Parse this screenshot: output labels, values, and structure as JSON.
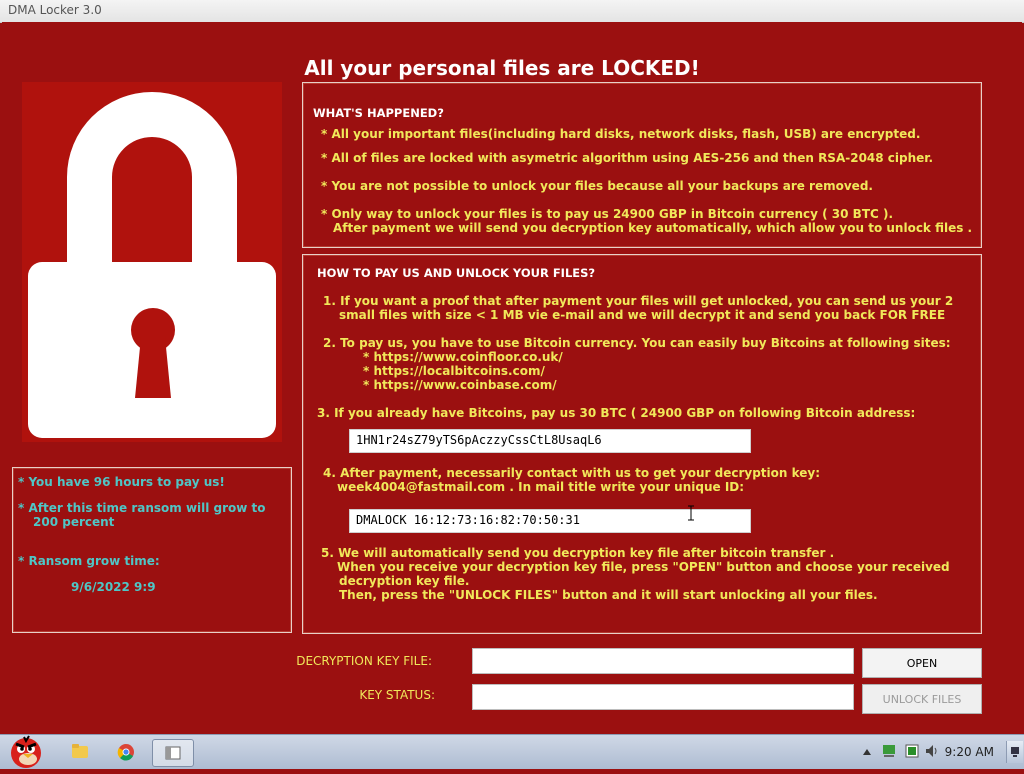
{
  "window": {
    "title": "DMA Locker 3.0"
  },
  "headline": "All your personal files are LOCKED!",
  "left_panel": {
    "lines": [
      "* You have 96 hours to pay us!",
      "* After this time ransom will grow to",
      "200 percent",
      "* Ransom grow time:",
      "9/6/2022 9:9"
    ]
  },
  "happened": {
    "heading": "WHAT'S HAPPENED?",
    "lines": [
      "* All your important files(including hard disks, network disks, flash, USB) are encrypted.",
      "* All of files are locked with asymetric algorithm using AES-256 and then RSA-2048 cipher.",
      "* You are not possible to unlock your files because all your backups are removed.",
      "* Only way to unlock your files is to pay us   24900 GBP in Bitcoin currency ( 30 BTC ).",
      "After payment we will send you decryption key automatically, which allow you to unlock files ."
    ]
  },
  "howto": {
    "heading": "HOW TO PAY US AND UNLOCK YOUR FILES?",
    "lines": [
      "1. If you want a proof that after payment your files will get unlocked, you can send us your 2",
      "small files with size < 1 MB vie e-mail and we will decrypt it and send you back FOR FREE",
      "2. To pay us, you have to use  Bitcoin   currency. You can easily buy Bitcoins at following sites:",
      "* https://www.coinfloor.co.uk/",
      "* https://localbitcoins.com/",
      "* https://www.coinbase.com/",
      "3. If you already have Bitcoins, pay us   30 BTC ( 24900 GBP    on following Bitcoin address:",
      "4. After payment, necessarily contact with us to get your decryption key:",
      "week4004@fastmail.com  . In mail title write your unique ID:",
      "5. We will automatically send you decryption key file after bitcoin transfer .",
      "When you receive your decryption key file, press \"OPEN\"  button and choose your received",
      "decryption key file.",
      "Then,  press the \"UNLOCK FILES\" button and it will start unlocking all your files."
    ],
    "bitcoin_address": "1HN1r24sZ79yTS6pAczzyCssCtL8UsaqL6",
    "unique_id": "DMALOCK 16:12:73:16:82:70:50:31"
  },
  "bottom": {
    "key_file_label": "DECRYPTION KEY FILE:",
    "key_status_label": "KEY STATUS:",
    "open_button": "OPEN",
    "unlock_button": "UNLOCK FILES",
    "key_file_value": "",
    "key_status_value": ""
  },
  "taskbar": {
    "time": "9:20 AM",
    "icons": [
      "angry-bird-start-icon",
      "folder-icon",
      "chrome-icon",
      "app-window-icon"
    ],
    "tray_icons": [
      "chevron-up-icon",
      "network-icon",
      "battery-icon",
      "volume-icon",
      "desktop-icon"
    ]
  },
  "colors": {
    "background": "#9b1010",
    "text_yellow": "#f1e85a",
    "white": "#ffffff"
  }
}
